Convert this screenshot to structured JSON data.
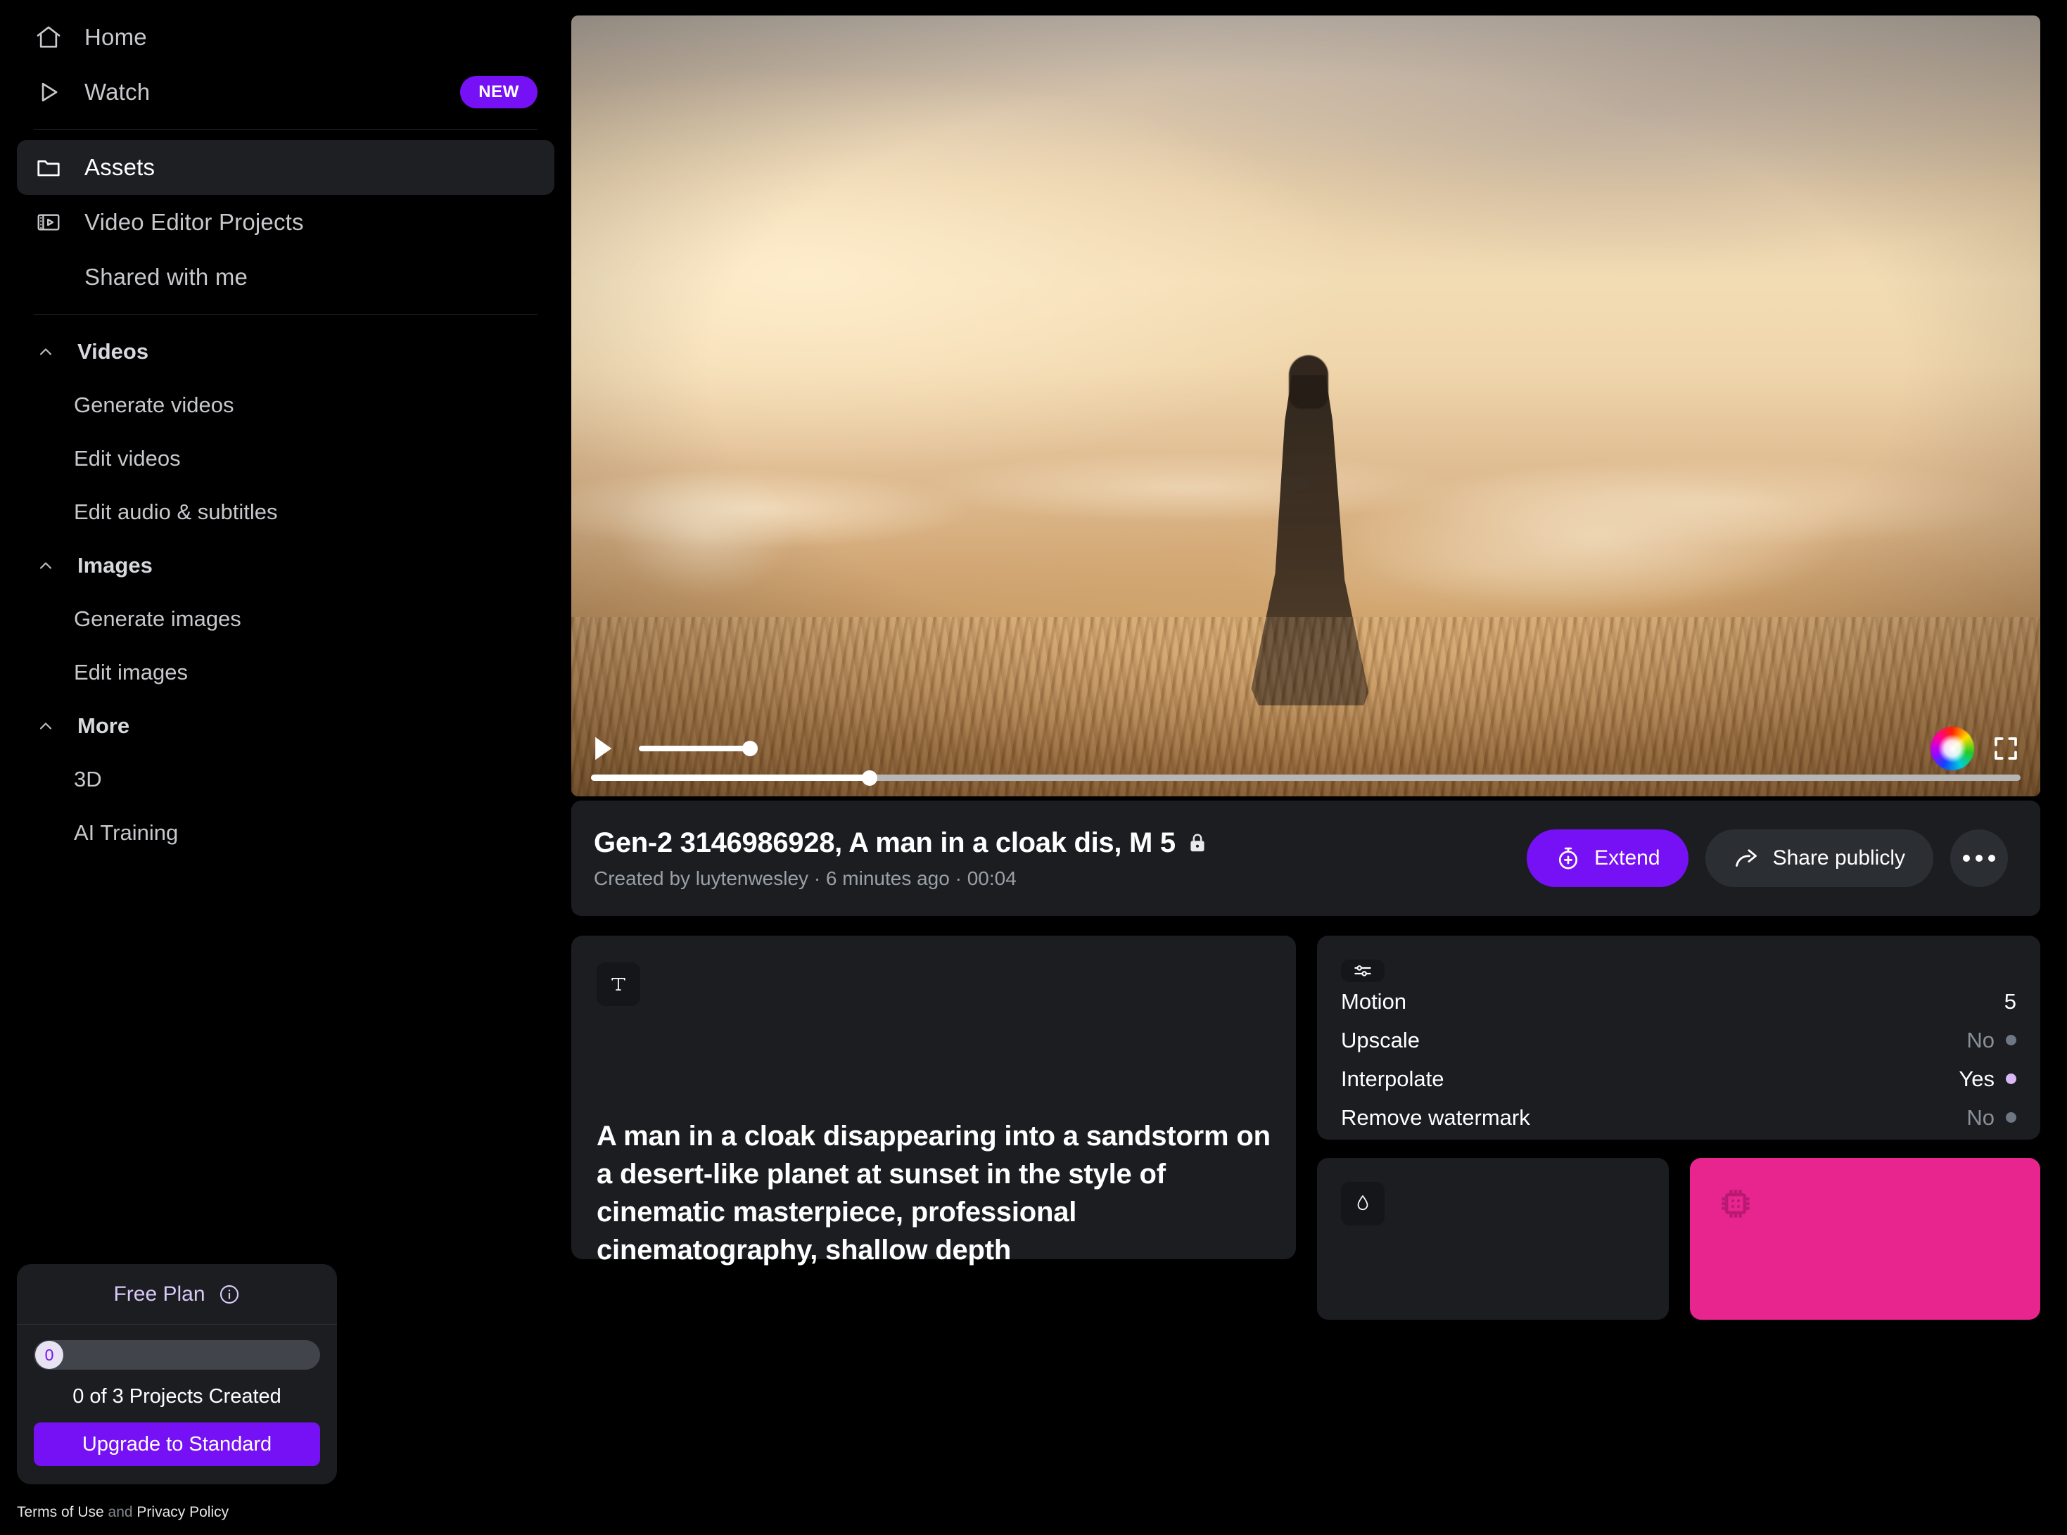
{
  "sidebar": {
    "top_items": [
      {
        "label": "Home",
        "icon": "home-icon",
        "badge": null
      },
      {
        "label": "Watch",
        "icon": "play-outline-icon",
        "badge": "NEW"
      }
    ],
    "section_items": [
      {
        "label": "Assets",
        "icon": "folder-icon",
        "active": true
      },
      {
        "label": "Video Editor Projects",
        "icon": "film-strip-icon",
        "active": false
      },
      {
        "label": "Shared with me",
        "icon": null,
        "active": false
      }
    ],
    "groups": [
      {
        "title": "Videos",
        "expanded": true,
        "items": [
          "Generate videos",
          "Edit videos",
          "Edit audio & subtitles"
        ]
      },
      {
        "title": "Images",
        "expanded": true,
        "items": [
          "Generate images",
          "Edit images"
        ]
      },
      {
        "title": "More",
        "expanded": true,
        "items": [
          "3D",
          "AI Training"
        ]
      }
    ],
    "plan": {
      "title": "Free Plan",
      "info_icon": "info-circle-icon",
      "progress_value": "0",
      "progress_percent": 0,
      "count_text": "0 of 3 Projects Created",
      "upgrade_label": "Upgrade to Standard"
    },
    "legal": {
      "terms": "Terms of Use",
      "and": " and ",
      "privacy": "Privacy Policy"
    }
  },
  "player": {
    "play_icon": "play-icon",
    "volume_percent": 100,
    "progress_percent": 19.5,
    "color_wheel_icon": "color-wheel-icon",
    "fullscreen_icon": "fullscreen-icon"
  },
  "asset": {
    "title": "Gen-2 3146986928, A man in a cloak dis, M 5",
    "lock_icon": "lock-icon",
    "meta": "Created by luytenwesley · 6 minutes ago · 00:04",
    "extend_label": "Extend",
    "extend_icon": "timer-plus-icon",
    "share_label": "Share publicly",
    "share_icon": "share-arrow-icon",
    "more_icon": "ellipsis-icon"
  },
  "prompt_card": {
    "icon": "text-t-icon",
    "text": "A man in a cloak disappearing into a sandstorm on a desert-like planet at sunset in the style of cinematic masterpiece, professional cinematography, shallow depth"
  },
  "settings_card": {
    "icon": "sliders-icon",
    "rows": [
      {
        "label": "Motion",
        "value": "5",
        "state": "on",
        "dot": null
      },
      {
        "label": "Upscale",
        "value": "No",
        "state": "off",
        "dot": "#6f7784"
      },
      {
        "label": "Interpolate",
        "value": "Yes",
        "state": "on",
        "dot": "#d9b8f5"
      },
      {
        "label": "Remove watermark",
        "value": "No",
        "state": "off",
        "dot": "#6f7784"
      }
    ]
  },
  "audio_card": {
    "icon": "droplet-icon"
  },
  "chip_card": {
    "icon": "chip-icon",
    "color": "#e8248f"
  },
  "colors": {
    "accent_purple": "#7611f5",
    "panel": "#1b1d21",
    "background": "#000000",
    "pink": "#e8248f"
  }
}
